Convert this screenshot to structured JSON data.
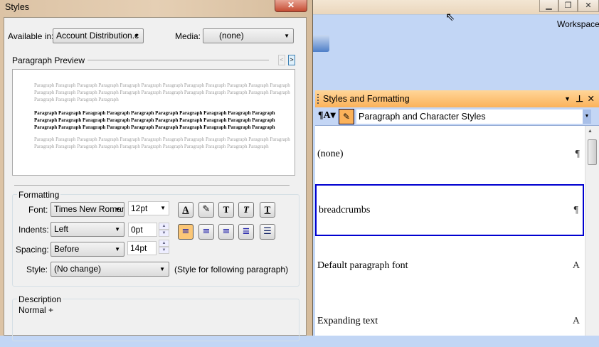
{
  "dialog": {
    "title": "Styles",
    "close_label": "✕",
    "available_in_label": "Available in:",
    "available_in_value": "Account Distribution.c",
    "media_label": "Media:",
    "media_value": "(none)",
    "preview_label": "Paragraph Preview",
    "prev_btn": "<",
    "next_btn": ">",
    "preview_gray_1": "Paragraph Paragraph Paragraph Paragraph Paragraph Paragraph Paragraph Paragraph Paragraph Paragraph Paragraph Paragraph Paragraph Paragraph Paragraph Paragraph Paragraph Paragraph Paragraph Paragraph Paragraph Paragraph Paragraph Paragraph Paragraph Paragraph Paragraph Paragraph",
    "preview_main": "Paragraph Paragraph Paragraph Paragraph Paragraph Paragraph Paragraph Paragraph Paragraph Paragraph Paragraph Paragraph Paragraph Paragraph Paragraph Paragraph Paragraph Paragraph Paragraph Paragraph Paragraph Paragraph Paragraph Paragraph Paragraph Paragraph Paragraph Paragraph Paragraph Paragraph",
    "preview_gray_2": "Paragraph Paragraph Paragraph Paragraph Paragraph Paragraph Paragraph Paragraph Paragraph Paragraph Paragraph Paragraph Paragraph Paragraph Paragraph Paragraph Paragraph Paragraph Paragraph Paragraph Paragraph Paragraph Paragraph",
    "formatting_label": "Formatting",
    "font_label": "Font:",
    "font_value": "Times New Roman",
    "size_value": "12pt",
    "indents_label": "Indents:",
    "indents_value": "Left",
    "indent_pt": "0pt",
    "spacing_label": "Spacing:",
    "spacing_value": "Before",
    "spacing_pt": "14pt",
    "style_label": "Style:",
    "style_value": "(No change)",
    "style_hint": "(Style for following paragraph)",
    "description_label": "Description",
    "description_value": "Normal +"
  },
  "window": {
    "workspace_label": "Workspace"
  },
  "panel": {
    "title": "Styles and Formatting",
    "filter_value": "Paragraph and Character Styles",
    "items": [
      {
        "name": "(none)",
        "icon": "¶"
      },
      {
        "name": "breadcrumbs",
        "icon": "¶"
      },
      {
        "name": "Default paragraph font",
        "icon": "A"
      },
      {
        "name": "Expanding text",
        "icon": "A"
      }
    ]
  }
}
